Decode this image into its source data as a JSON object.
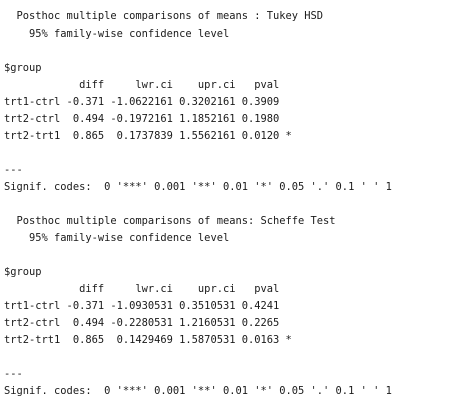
{
  "output": {
    "tukey": {
      "title": "  Posthoc multiple comparisons of means : Tukey HSD",
      "conf": "    95% family-wise confidence level",
      "group": "$group",
      "header": "            diff     lwr.ci    upr.ci   pval",
      "rows": [
        "trt1-ctrl -0.371 -1.0622161 0.3202161 0.3909",
        "trt2-ctrl  0.494 -0.1972161 1.1852161 0.1980",
        "trt2-trt1  0.865  0.1737839 1.5562161 0.0120 *"
      ],
      "sep": "---",
      "signif": "Signif. codes:  0 '***' 0.001 '**' 0.01 '*' 0.05 '.' 0.1 ' ' 1"
    },
    "scheffe": {
      "title": "  Posthoc multiple comparisons of means: Scheffe Test",
      "conf": "    95% family-wise confidence level",
      "group": "$group",
      "header": "            diff     lwr.ci    upr.ci   pval",
      "rows": [
        "trt1-ctrl -0.371 -1.0930531 0.3510531 0.4241",
        "trt2-ctrl  0.494 -0.2280531 1.2160531 0.2265",
        "trt2-trt1  0.865  0.1429469 1.5870531 0.0163 *"
      ],
      "sep": "---",
      "signif": "Signif. codes:  0 '***' 0.001 '**' 0.01 '*' 0.05 '.' 0.1 ' ' 1"
    }
  }
}
